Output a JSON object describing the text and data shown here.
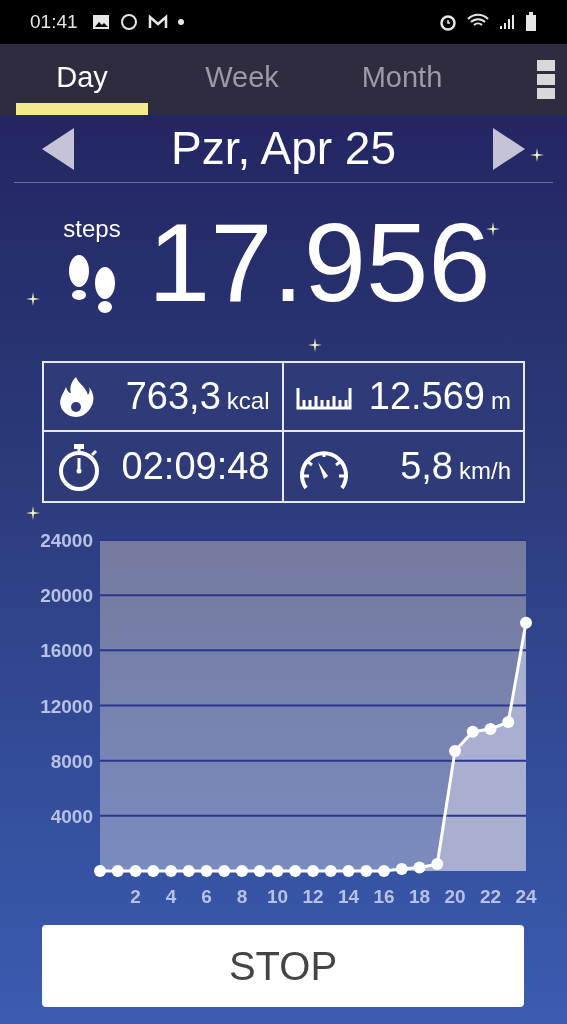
{
  "status_bar": {
    "time": "01:41"
  },
  "tabs": [
    {
      "label": "Day",
      "selected": true
    },
    {
      "label": "Week",
      "selected": false
    },
    {
      "label": "Month",
      "selected": false
    }
  ],
  "date": {
    "title": "Pzr, Apr 25"
  },
  "steps": {
    "label": "steps",
    "value": "17.956"
  },
  "stats": [
    {
      "kind": "calories",
      "value": "763,3",
      "unit": "kcal"
    },
    {
      "kind": "distance",
      "value": "12.569",
      "unit": "m"
    },
    {
      "kind": "duration",
      "value": "02:09:48"
    },
    {
      "kind": "speed",
      "value": "5,8",
      "unit": "km/h"
    }
  ],
  "chart_data": {
    "type": "area",
    "x": [
      0,
      1,
      2,
      3,
      4,
      5,
      6,
      7,
      8,
      9,
      10,
      11,
      12,
      13,
      14,
      15,
      16,
      17,
      18,
      19,
      20,
      21,
      22,
      23,
      24
    ],
    "series": [
      {
        "color": "#ffffff",
        "values": [
          0,
          0,
          0,
          0,
          0,
          0,
          0,
          0,
          0,
          0,
          0,
          0,
          0,
          0,
          0,
          0,
          0,
          150,
          250,
          500,
          8700,
          10100,
          10300,
          10800,
          18000
        ]
      }
    ],
    "grid": true,
    "xlim": [
      0,
      24
    ],
    "ylim": [
      0,
      24000
    ],
    "xticks": [
      2,
      4,
      6,
      8,
      10,
      12,
      14,
      16,
      18,
      20,
      22,
      24
    ],
    "yticks": [
      4000,
      8000,
      12000,
      16000,
      20000,
      24000
    ]
  },
  "button": {
    "label": "STOP"
  }
}
